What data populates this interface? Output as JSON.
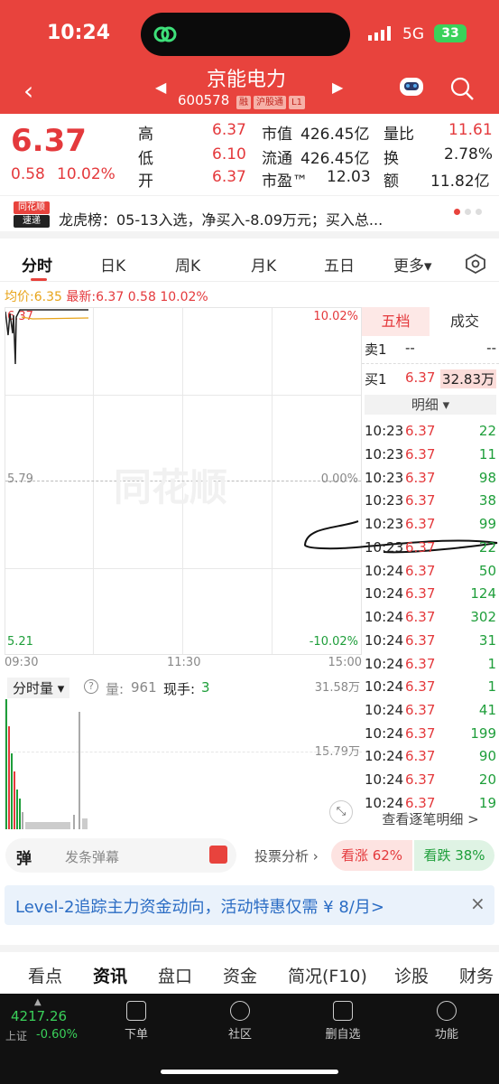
{
  "status": {
    "time": "10:24",
    "network": "5G",
    "battery": "33"
  },
  "header": {
    "name": "京能电力",
    "code": "600578",
    "tags": [
      "融",
      "沪股通",
      "L1"
    ]
  },
  "quote": {
    "price": "6.37",
    "change": "0.58",
    "change_pct": "10.02%",
    "high_label": "高",
    "high": "6.37",
    "low_label": "低",
    "low": "6.10",
    "open_label": "开",
    "open": "6.37",
    "mcap_label": "市值",
    "mcap": "426.45亿",
    "float_label": "流通",
    "float": "426.45亿",
    "pe_label": "市盈™",
    "pe": "12.03",
    "vr_label": "量比",
    "vr": "11.61",
    "turn_label": "换",
    "turn": "2.78%",
    "amt_label": "额",
    "amt": "11.82亿"
  },
  "news": {
    "logo_top": "同花顺",
    "logo_bottom": "速递",
    "text": "龙虎榜：05-13入选，净买入-8.09万元；买入总..."
  },
  "tabs": [
    "分时",
    "日K",
    "周K",
    "月K",
    "五日",
    "更多▾"
  ],
  "chart_info": {
    "avg_label": "均价:",
    "avg": "6.35",
    "latest_label": "最新:",
    "latest": "6.37",
    "chg": "0.58",
    "pct": "10.02%"
  },
  "chart_axis": {
    "top_price": "6.37",
    "mid_price": "5.79",
    "bottom_price": "5.21",
    "top_pct": "10.02%",
    "mid_pct": "0.00%",
    "bottom_pct": "-10.02%",
    "t_start": "09:30",
    "t_mid": "11:30",
    "t_end": "15:00"
  },
  "watermark": "同花顺",
  "panel": {
    "tab_active": "五档",
    "tab_other": "成交",
    "sell1_label": "卖1",
    "sell1_price": "--",
    "sell1_vol": "--",
    "buy1_label": "买1",
    "buy1_price": "6.37",
    "buy1_vol": "32.83万",
    "detail_label": "明细 ▾",
    "ticks": [
      {
        "t": "10:23",
        "p": "6.37",
        "v": "22"
      },
      {
        "t": "10:23",
        "p": "6.37",
        "v": "11"
      },
      {
        "t": "10:23",
        "p": "6.37",
        "v": "98"
      },
      {
        "t": "10:23",
        "p": "6.37",
        "v": "38"
      },
      {
        "t": "10:23",
        "p": "6.37",
        "v": "99"
      },
      {
        "t": "10:23",
        "p": "6.37",
        "v": "22"
      },
      {
        "t": "10:24",
        "p": "6.37",
        "v": "50"
      },
      {
        "t": "10:24",
        "p": "6.37",
        "v": "124"
      },
      {
        "t": "10:24",
        "p": "6.37",
        "v": "302"
      },
      {
        "t": "10:24",
        "p": "6.37",
        "v": "31"
      },
      {
        "t": "10:24",
        "p": "6.37",
        "v": "1"
      },
      {
        "t": "10:24",
        "p": "6.37",
        "v": "1"
      },
      {
        "t": "10:24",
        "p": "6.37",
        "v": "41"
      },
      {
        "t": "10:24",
        "p": "6.37",
        "v": "199"
      },
      {
        "t": "10:24",
        "p": "6.37",
        "v": "90"
      },
      {
        "t": "10:24",
        "p": "6.37",
        "v": "20"
      },
      {
        "t": "10:24",
        "p": "6.37",
        "v": "19"
      }
    ],
    "view_all": "查看逐笔明细 >"
  },
  "volume": {
    "selector": "分时量 ▾",
    "vol_label": "量:",
    "vol": "961",
    "hand_label": "现手:",
    "hand": "3",
    "max": "31.58万",
    "mid": "15.79万"
  },
  "bullet": {
    "icon": "弹",
    "placeholder": "发条弹幕",
    "vote_label": "投票分析 ›",
    "up": "看涨 62%",
    "down": "看跌 38%"
  },
  "promo": {
    "text": "Level-2追踪主力资金动向，活动特惠仅需 ¥ 8/月>"
  },
  "subtabs": [
    "看点",
    "资讯",
    "盘口",
    "资金",
    "简况(F10)",
    "诊股",
    "财务"
  ],
  "bottom": {
    "index_value": "4217.26",
    "index_name": "上证",
    "index_pct": "-0.60%",
    "items": [
      "下单",
      "社区",
      "删自选",
      "功能"
    ]
  }
}
